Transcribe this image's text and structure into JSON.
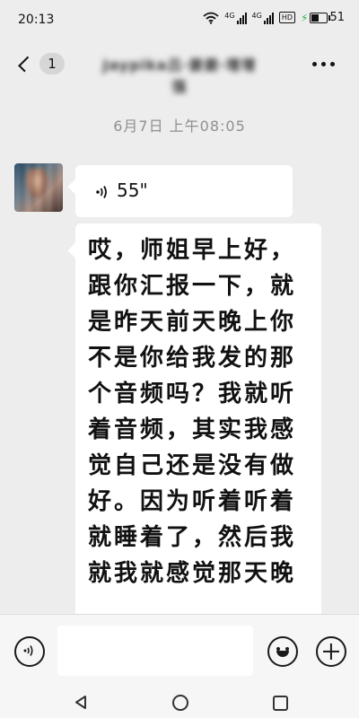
{
  "status_bar": {
    "time": "20:13",
    "network_1": "4G",
    "network_2": "4G",
    "hd": "HD",
    "battery": "51",
    "charging_color": "#2bb24c"
  },
  "nav": {
    "unread_count": "1",
    "contact_name": "Jaypika吕·姜姜·增增强",
    "icons": {
      "back": "chevron-left-icon",
      "more": "more-dots-icon"
    }
  },
  "chat": {
    "timestamp": "6月7日  上午08:05",
    "voice_message": {
      "duration": "55\""
    },
    "text_message": "哎，师姐早上好，跟你汇报一下，就是昨天前天晚上你不是你给我发的那个音频吗？我就听着音频，其实我感觉自己还是没有做好。因为听着听着就睡着了，然后我就我就感觉那天晚"
  },
  "input_bar": {
    "placeholder": "",
    "icons": {
      "voice": "voice-mode-icon",
      "emoji": "emoji-icon",
      "plus": "plus-icon"
    }
  },
  "system_nav": {
    "icons": [
      "back-triangle-icon",
      "home-circle-icon",
      "recent-square-icon"
    ]
  }
}
